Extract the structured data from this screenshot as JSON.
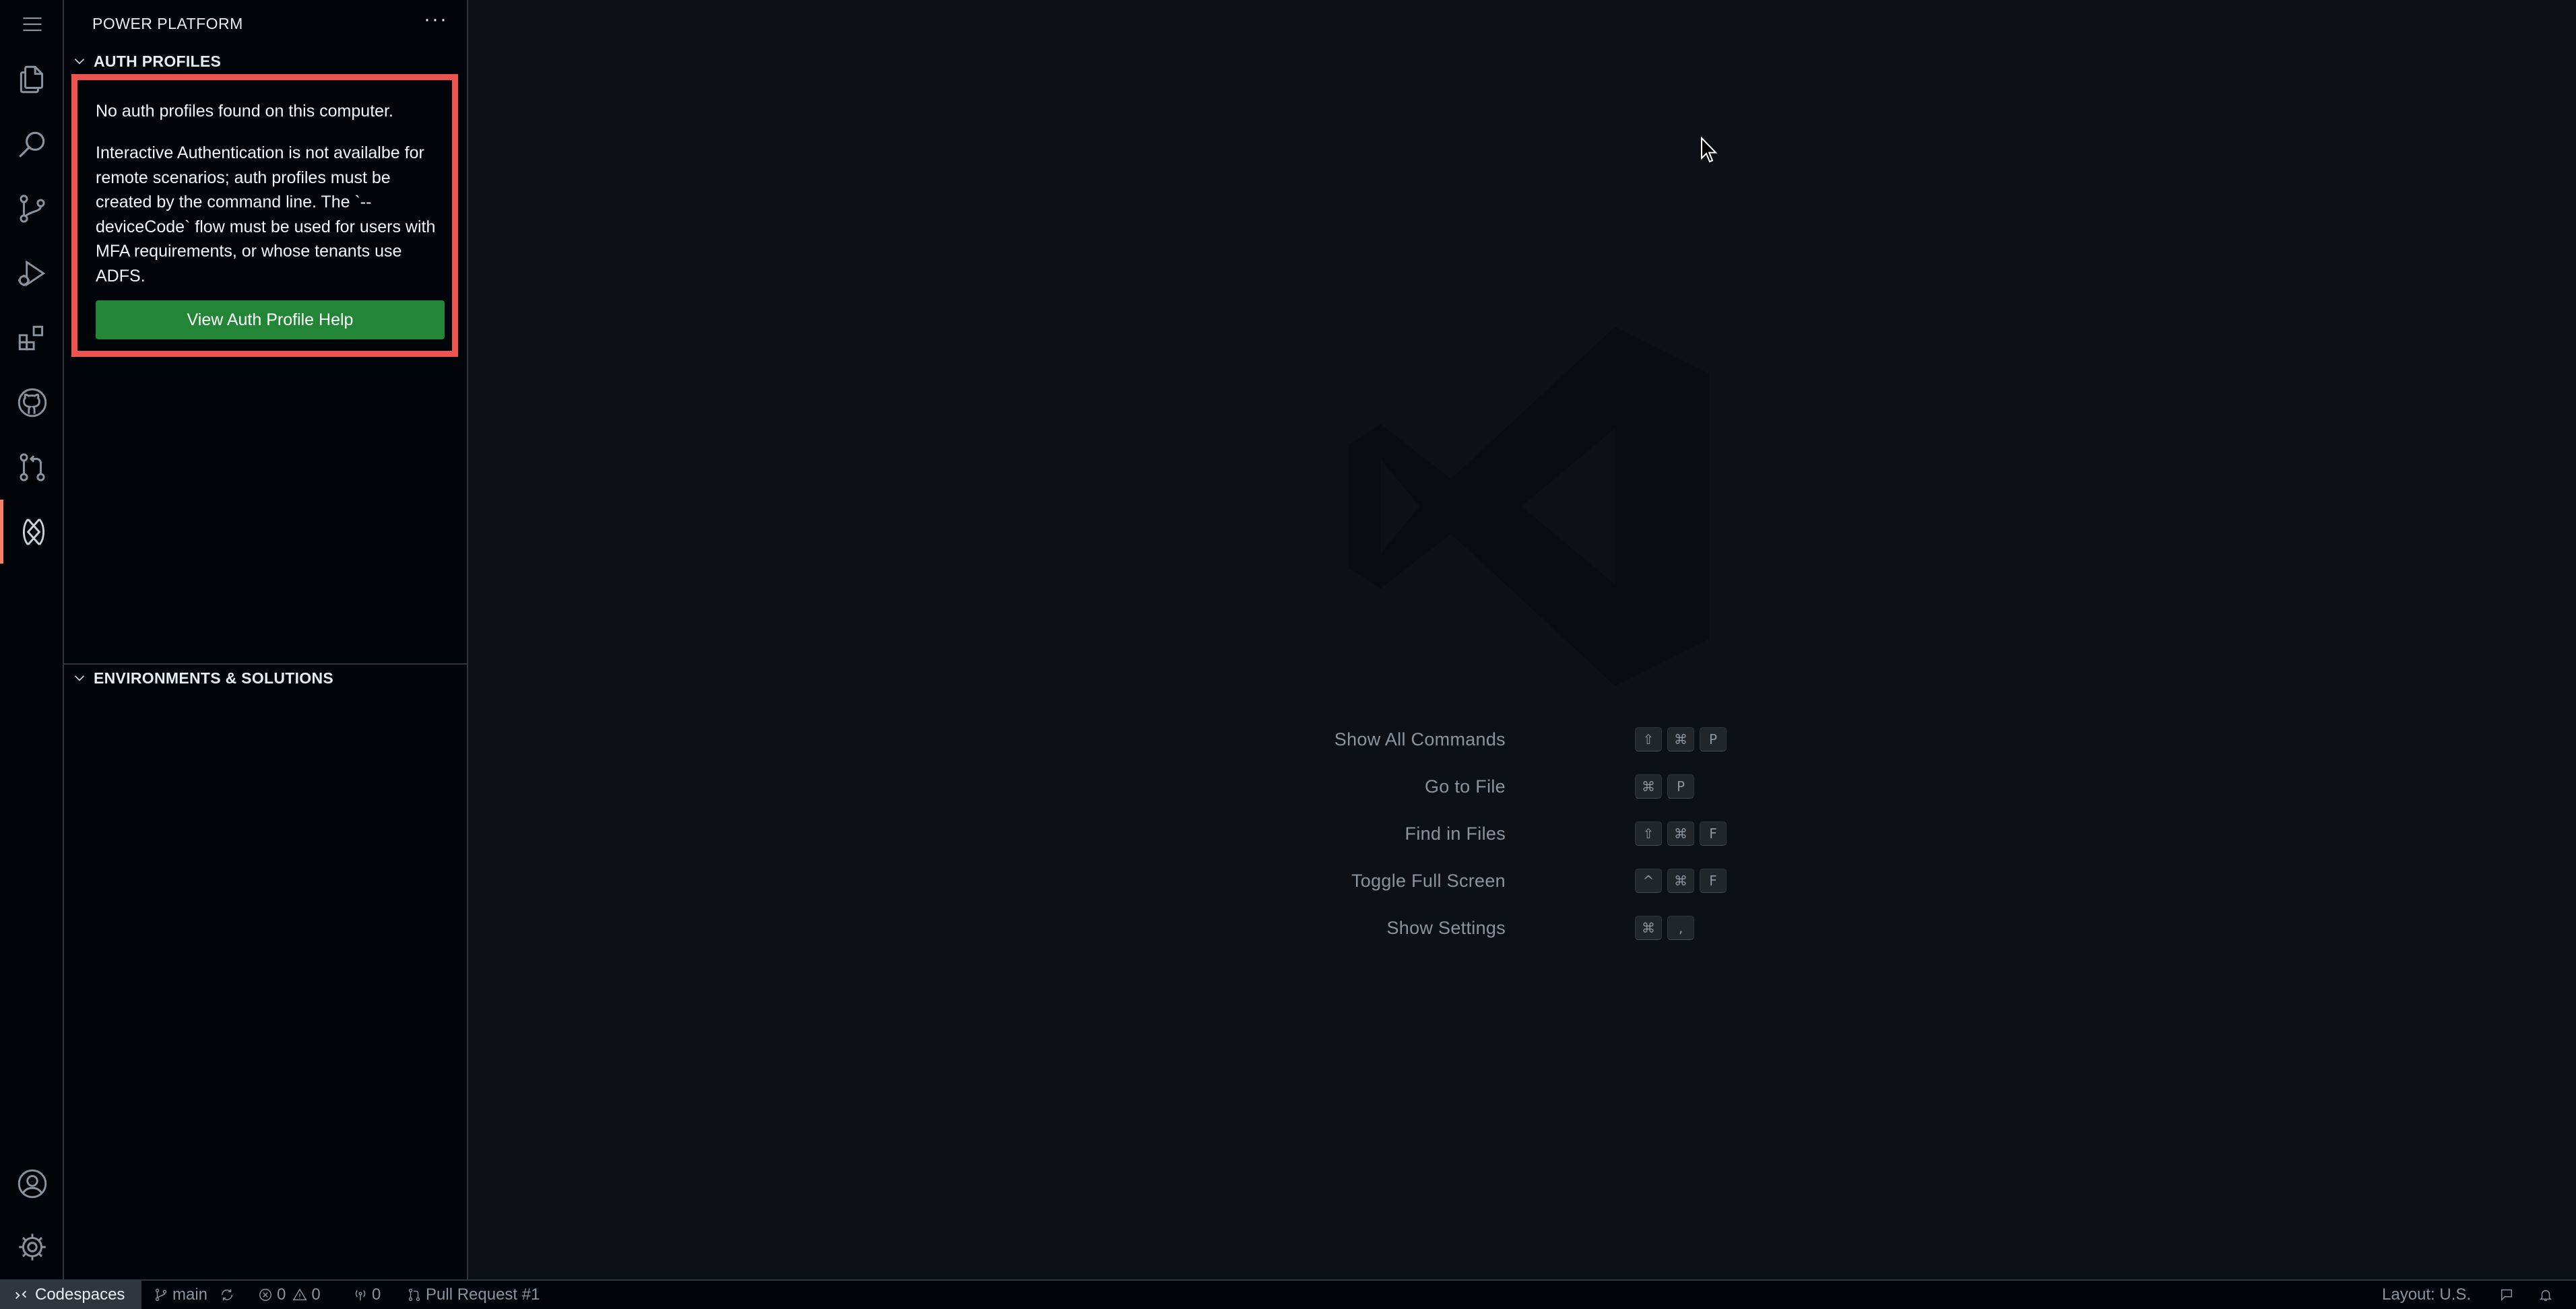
{
  "sidebar": {
    "title": "POWER PLATFORM",
    "more": "···",
    "auth_section": {
      "header": "AUTH PROFILES",
      "message1": "No auth profiles found on this computer.",
      "message2": "Interactive Authentication is not availalbe for remote scenarios; auth profiles must be created by the command line. The `--deviceCode` flow must be used for users with MFA requirements, or whose tenants use ADFS.",
      "button": "View Auth Profile Help"
    },
    "env_section": {
      "header": "ENVIRONMENTS & SOLUTIONS"
    }
  },
  "activity_bar": {
    "icons": [
      "menu-icon",
      "files-icon",
      "search-icon",
      "source-control-icon",
      "run-debug-icon",
      "extensions-icon",
      "github-icon",
      "pull-requests-icon",
      "power-platform-icon",
      "account-icon",
      "settings-gear-icon"
    ]
  },
  "editor": {
    "shortcuts": [
      {
        "label": "Show All Commands",
        "keys": [
          "⇧",
          "⌘",
          "P"
        ]
      },
      {
        "label": "Go to File",
        "keys": [
          "⌘",
          "P"
        ]
      },
      {
        "label": "Find in Files",
        "keys": [
          "⇧",
          "⌘",
          "F"
        ]
      },
      {
        "label": "Toggle Full Screen",
        "keys": [
          "^",
          "⌘",
          "F"
        ]
      },
      {
        "label": "Show Settings",
        "keys": [
          "⌘",
          ","
        ]
      }
    ]
  },
  "statusbar": {
    "remote": "Codespaces",
    "branch": "main",
    "errors": "0",
    "warnings": "0",
    "ports": "0",
    "pull_request": "Pull Request #1",
    "layout": "Layout: U.S."
  },
  "colors": {
    "accent_active": "#f78166",
    "button_bg": "#238636",
    "highlight_border": "#ef5350",
    "background": "#0d1117"
  }
}
